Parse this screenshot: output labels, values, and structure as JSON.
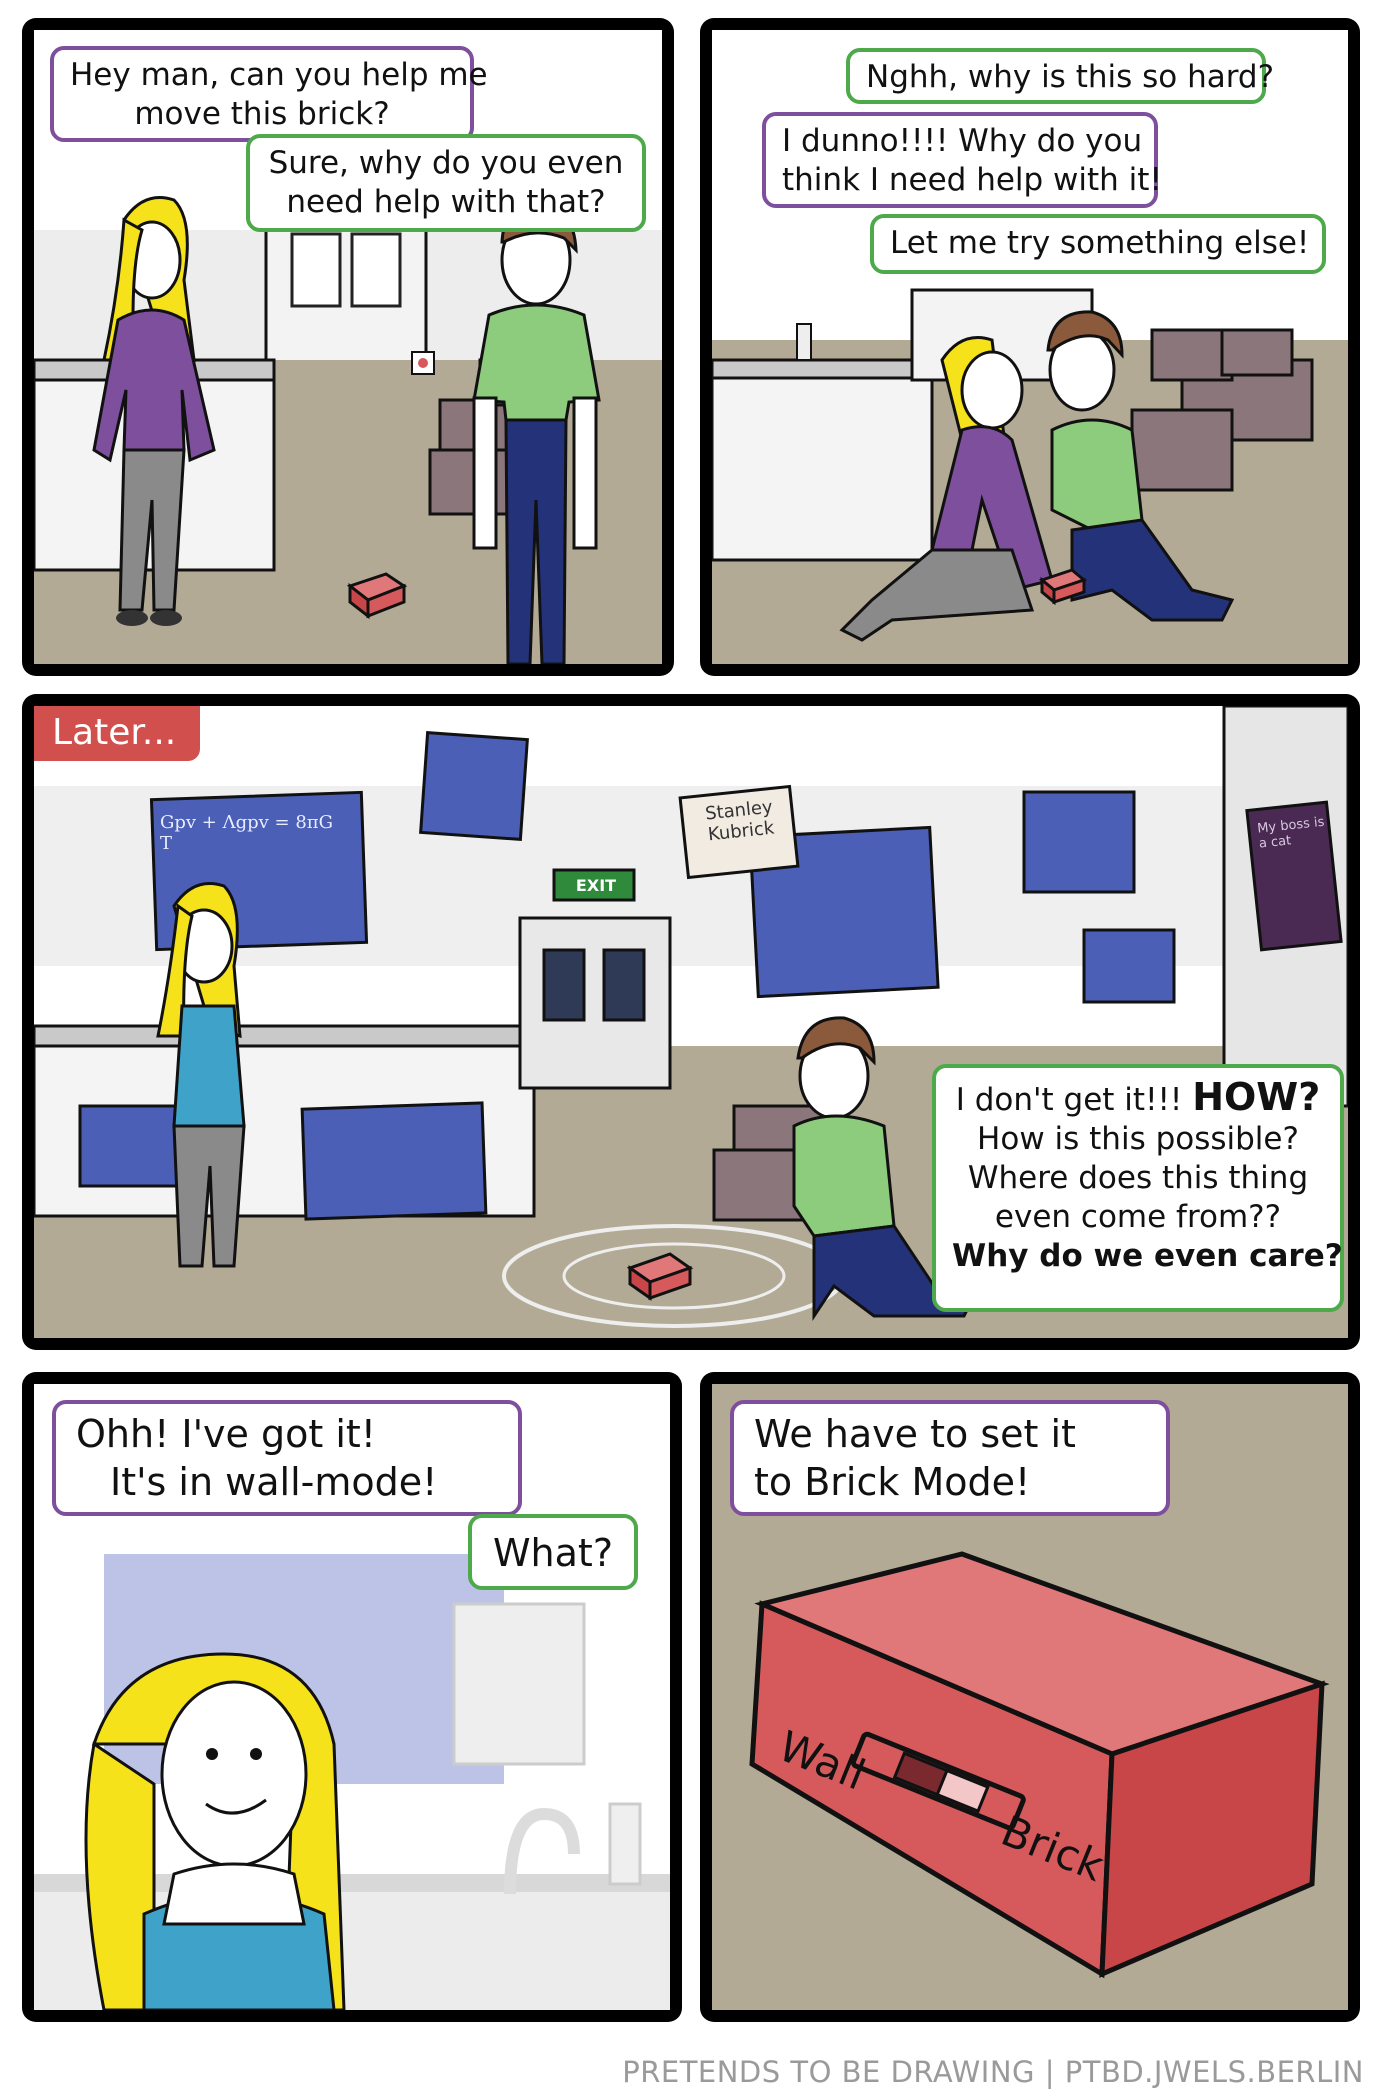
{
  "comic": {
    "panel1": {
      "bubble_a": [
        "Hey man, can you help me",
        "move this brick?"
      ],
      "bubble_b": [
        "Sure, why do you even",
        "need help with that?"
      ]
    },
    "panel2": {
      "bubble_a": [
        "Nghh, why is this so hard?"
      ],
      "bubble_b": [
        "I dunno!!!! Why do you",
        "think I need help with it!"
      ],
      "bubble_c": [
        "Let me try something else!"
      ]
    },
    "panel3": {
      "caption": "Later...",
      "exit_sign": "EXIT",
      "poster_name": [
        "Stanley",
        "Kubrick"
      ],
      "poster_cat": "My boss is a cat",
      "board_text": "Gpv + Λgpv = 8πG T",
      "bubble_lines": [
        "I don't get it!!! ",
        "How is this possible?",
        "Where does this thing",
        "even come from??",
        "Why do we even care?"
      ],
      "bubble_how": "HOW?"
    },
    "panel4": {
      "bubble_a": [
        "Ohh! I've got it!",
        "It's in wall-mode!"
      ],
      "bubble_b": [
        "What?"
      ]
    },
    "panel5": {
      "bubble_a": [
        "We have to set it",
        "to Brick Mode!"
      ],
      "switch_left": "Wall",
      "switch_right": "Brick"
    }
  },
  "footer": "PRETENDS TO BE DRAWING | PTBD.JWELS.BERLIN",
  "colors": {
    "purple_border": "#7e4f9d",
    "green_border": "#4ea94b",
    "brick": "#d65a5c",
    "floor": "#b3aa96",
    "blueprint": "#4a5fb5",
    "caption": "#d1504e"
  }
}
